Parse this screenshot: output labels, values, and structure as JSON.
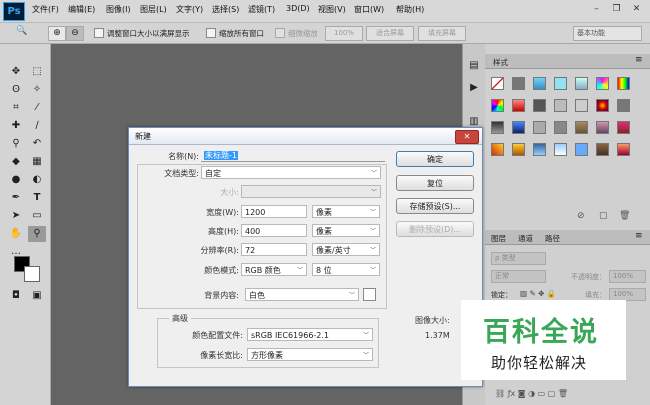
{
  "app": {
    "logo": "Ps"
  },
  "menubar": {
    "items": [
      "文件(F)",
      "编辑(E)",
      "图像(I)",
      "图层(L)",
      "文字(Y)",
      "选择(S)",
      "滤镜(T)",
      "3D(D)",
      "视图(V)",
      "窗口(W)",
      "帮助(H)"
    ],
    "minimize": "–",
    "restore": "❐",
    "close": "✕"
  },
  "options_bar": {
    "zoom_tool_icon": "🔍",
    "zoom_in_icon": "⊕",
    "zoom_out_icon": "⊖",
    "resize_windows_label": "调整窗口大小以满屏显示",
    "zoom_all_label": "缩放所有窗口",
    "scrubby_label": "细微缩放",
    "zoom_value": "100%",
    "fit_screen": "适合屏幕",
    "fill_screen": "填充屏幕",
    "workspace": "基本功能"
  },
  "styles_panel": {
    "tab": "样式"
  },
  "layers_panel": {
    "tabs": [
      "图层",
      "通道",
      "路径"
    ],
    "kind_filter": "ρ 类型",
    "blend_mode": "正常",
    "opacity_label": "不透明度：",
    "opacity_value": "100%",
    "lock_label": "锁定：",
    "fill_label": "填充：",
    "fill_value": "100%"
  },
  "dialog": {
    "title": "新建",
    "close": "✕",
    "name_label": "名称(N):",
    "name_value": "未标题-1",
    "preset_label": "文档类型:",
    "preset_value": "自定",
    "size_label": "大小:",
    "width_label": "宽度(W):",
    "width_value": "1200",
    "width_unit": "像素",
    "height_label": "高度(H):",
    "height_value": "400",
    "height_unit": "像素",
    "resolution_label": "分辨率(R):",
    "resolution_value": "72",
    "resolution_unit": "像素/英寸",
    "color_mode_label": "颜色模式:",
    "color_mode_value": "RGB 颜色",
    "bit_depth_value": "8 位",
    "background_label": "背景内容:",
    "background_value": "白色",
    "advanced_label": "高级",
    "color_profile_label": "颜色配置文件:",
    "color_profile_value": "sRGB IEC61966-2.1",
    "pixel_aspect_label": "像素长宽比:",
    "pixel_aspect_value": "方形像素",
    "ok": "确定",
    "reset": "复位",
    "save_preset": "存储预设(S)...",
    "delete_preset": "删除预设(D)...",
    "image_size_label": "图像大小:",
    "image_size_value": "1.37M"
  },
  "watermark": {
    "title": "百科全说",
    "subtitle": "助你轻松解决"
  },
  "colors": {
    "accent": "#2b78c9",
    "watermark_green": "#3aa657"
  }
}
